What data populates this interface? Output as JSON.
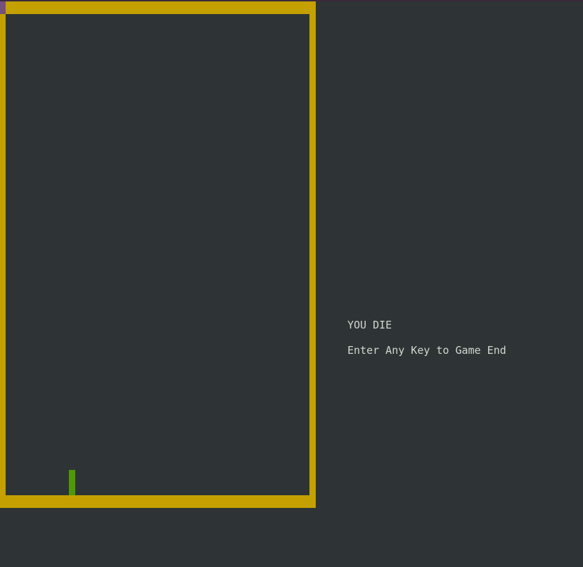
{
  "colors": {
    "background": "#2e3436",
    "wall": "#c4a000",
    "snake": "#4e9a06",
    "corner_marker": "#75507b",
    "text": "#d3d7cf"
  },
  "game": {
    "status_message": "YOU DIE",
    "prompt_message": "Enter Any Key to Game End"
  }
}
